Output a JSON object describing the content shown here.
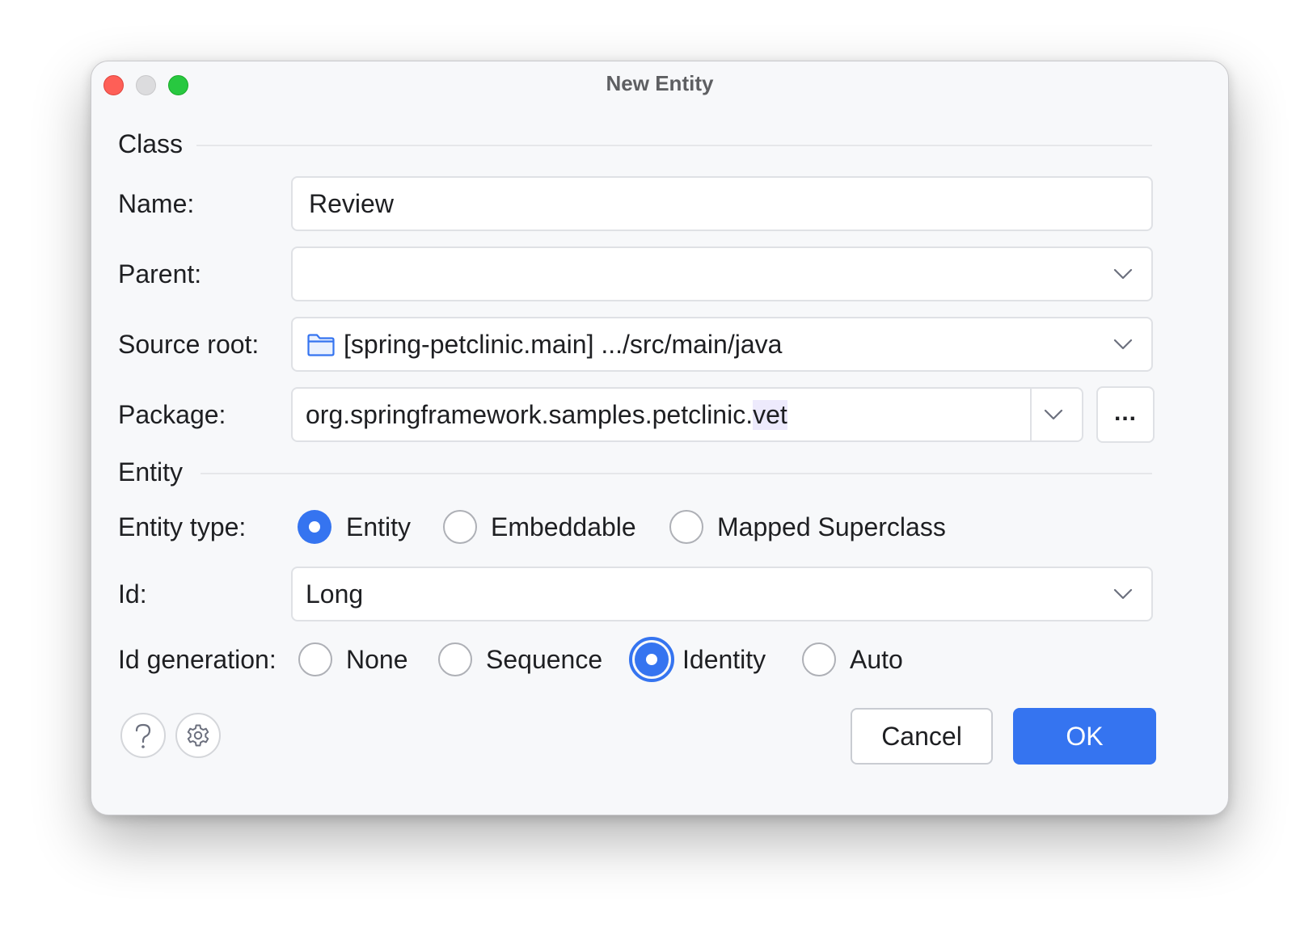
{
  "window": {
    "title": "New Entity"
  },
  "class_section": {
    "title": "Class",
    "name": {
      "label": "Name:",
      "value": "Review"
    },
    "parent": {
      "label": "Parent:",
      "value": ""
    },
    "source_root": {
      "label": "Source root:",
      "value": "[spring-petclinic.main] .../src/main/java"
    },
    "package": {
      "label": "Package:",
      "value_prefix": "org.springframework.samples.petclinic.",
      "value_suffix": "vet",
      "browse_label": "..."
    }
  },
  "entity_section": {
    "title": "Entity",
    "entity_type": {
      "label": "Entity type:",
      "options": [
        "Entity",
        "Embeddable",
        "Mapped Superclass"
      ],
      "selected": "Entity"
    },
    "id": {
      "label": "Id:",
      "value": "Long"
    },
    "id_generation": {
      "label": "Id generation:",
      "options": [
        "None",
        "Sequence",
        "Identity",
        "Auto"
      ],
      "selected": "Identity"
    }
  },
  "footer": {
    "help_icon": "question-mark-icon",
    "settings_icon": "gear-icon",
    "cancel_label": "Cancel",
    "ok_label": "OK"
  },
  "colors": {
    "accent": "#3574f0",
    "close": "#fe5f57",
    "minimize": "#dcdcde",
    "maximize": "#28c840",
    "folder_icon": "#3574f0"
  }
}
